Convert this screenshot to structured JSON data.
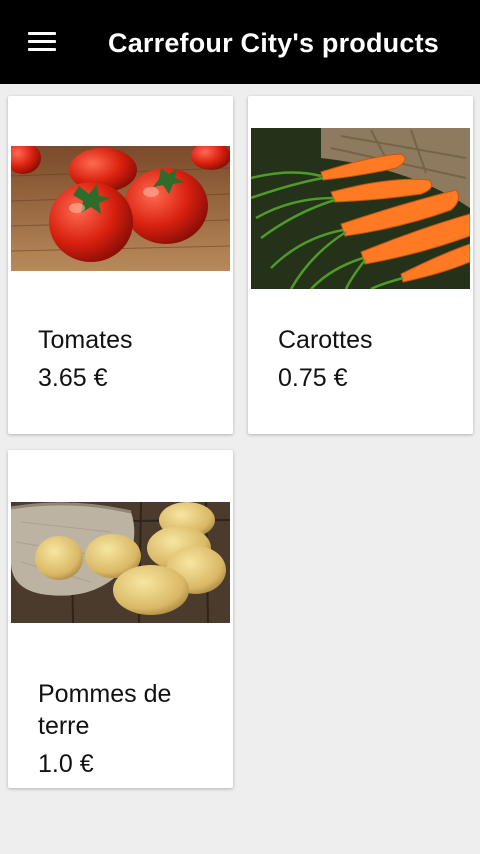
{
  "appbar": {
    "title": "Carrefour City's products",
    "menu_icon": "hamburger-menu-icon"
  },
  "colors": {
    "appbar": "#000000",
    "background": "#eeeeee",
    "card": "#ffffff"
  },
  "products": [
    {
      "name": "Tomates",
      "price": "3.65 €",
      "image_icon": "tomatoes-photo"
    },
    {
      "name": "Carottes",
      "price": "0.75 €",
      "image_icon": "carrots-photo"
    },
    {
      "name": "Pommes de terre",
      "price": "1.0 €",
      "image_icon": "potatoes-photo"
    }
  ]
}
